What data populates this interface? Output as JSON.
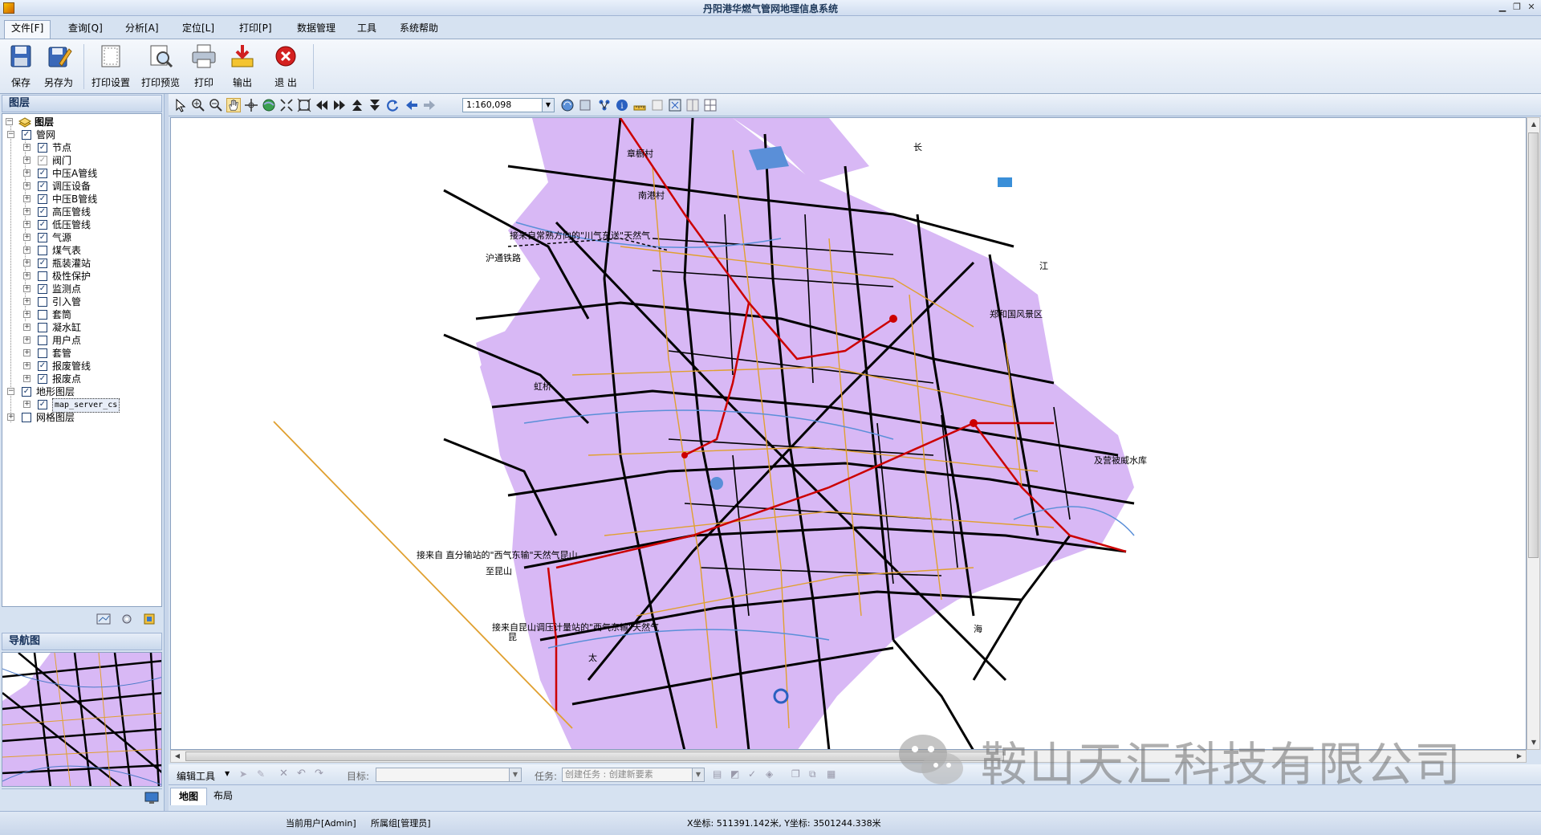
{
  "window": {
    "title": "丹阳港华燃气管网地理信息系统"
  },
  "menu": [
    "文件[F]",
    "查询[Q]",
    "分析[A]",
    "定位[L]",
    "打印[P]",
    "数据管理",
    "工具",
    "系统帮助"
  ],
  "ribbon": {
    "buttons": [
      {
        "label": "保存",
        "icon": "save-icon"
      },
      {
        "label": "另存为",
        "icon": "save-as-icon"
      },
      {
        "label": "打印设置",
        "icon": "print-setup-icon"
      },
      {
        "label": "打印预览",
        "icon": "print-preview-icon"
      },
      {
        "label": "打印",
        "icon": "printer-icon"
      },
      {
        "label": "输出",
        "icon": "export-icon"
      },
      {
        "label": "退 出",
        "icon": "exit-icon"
      }
    ]
  },
  "layers_panel": {
    "title": "图层",
    "root": "图层",
    "items": [
      {
        "label": "管网",
        "checked": true,
        "level": 1
      },
      {
        "label": "节点",
        "checked": true,
        "level": 2
      },
      {
        "label": "阀门",
        "checked": true,
        "gray": true,
        "level": 2
      },
      {
        "label": "中压A管线",
        "checked": true,
        "level": 2
      },
      {
        "label": "调压设备",
        "checked": true,
        "level": 2
      },
      {
        "label": "中压B管线",
        "checked": true,
        "level": 2
      },
      {
        "label": "高压管线",
        "checked": true,
        "level": 2
      },
      {
        "label": "低压管线",
        "checked": true,
        "level": 2
      },
      {
        "label": "气源",
        "checked": true,
        "level": 2
      },
      {
        "label": "煤气表",
        "checked": false,
        "level": 2
      },
      {
        "label": "瓶装灌站",
        "checked": true,
        "level": 2
      },
      {
        "label": "极性保护",
        "checked": false,
        "level": 2
      },
      {
        "label": "监测点",
        "checked": true,
        "level": 2
      },
      {
        "label": "引入管",
        "checked": false,
        "level": 2
      },
      {
        "label": "套筒",
        "checked": false,
        "level": 2
      },
      {
        "label": "凝水缸",
        "checked": false,
        "level": 2
      },
      {
        "label": "用户点",
        "checked": false,
        "level": 2
      },
      {
        "label": "套管",
        "checked": false,
        "level": 2
      },
      {
        "label": "报废管线",
        "checked": true,
        "level": 2
      },
      {
        "label": "报废点",
        "checked": true,
        "level": 2
      },
      {
        "label": "地形图层",
        "checked": true,
        "level": 1
      },
      {
        "label": "map_server_cs",
        "checked": true,
        "level": 2,
        "selected": true
      },
      {
        "label": "网格图层",
        "checked": false,
        "level": 1
      }
    ]
  },
  "nav_panel": {
    "title": "导航图"
  },
  "map_toolbar": {
    "scale": "1:160,098"
  },
  "edit_toolbar": {
    "edit_tools": "编辑工具",
    "target_label": "目标:",
    "target_value": "",
    "task_label": "任务:",
    "task_value": "创建任务 : 创建新要素"
  },
  "tabs": [
    "地图",
    "布局"
  ],
  "status": {
    "user": "当前用户[Admin]",
    "group": "所属组[管理员]",
    "coords": "X坐标: 511391.142米, Y坐标: 3501244.338米"
  },
  "map_labels": [
    "接来自常熟方向的\"川气东送\"天然气",
    "接来自 直分输站的\"西气东输\"天然气昆山",
    "接来自昆山调压计量站的\"西气东输\"天然气",
    "沪通铁路",
    "江",
    "长",
    "及营被威水库",
    "郑和国风景区",
    "至昆山",
    "南港村",
    "章橱村",
    "虹桥",
    "昆",
    "太",
    "海"
  ],
  "watermark": "鞍山天汇科技有限公司",
  "colors": {
    "accent": "#d6e2f1",
    "land": "#d8b8f5",
    "medium_pipe": "#e0a030",
    "high_pipe": "#cc0000",
    "road": "#000000",
    "water": "#5a8fd8"
  }
}
